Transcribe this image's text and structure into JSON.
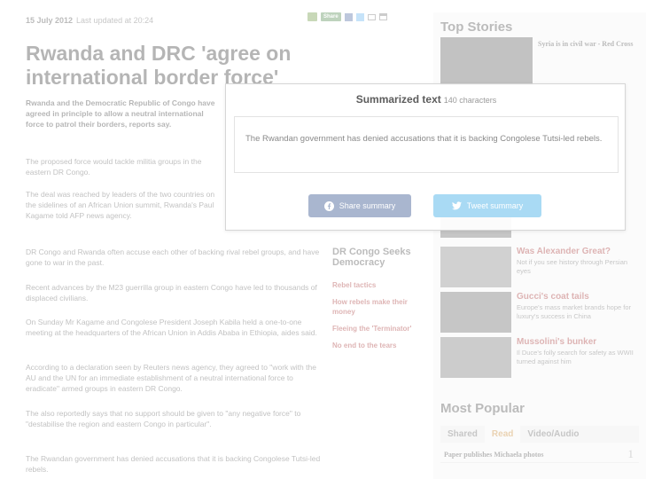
{
  "article": {
    "date": "15 July 2012",
    "updated": "Last updated at 20:24",
    "share_label": "Share",
    "headline": "Rwanda and DRC 'agree on international border force'",
    "lead": "Rwanda and the Democratic Republic of Congo have agreed in principle to allow a neutral international force to patrol their borders, reports say.",
    "paragraphs": [
      "The proposed force would tackle militia groups in the eastern DR Congo.",
      "The deal was reached by leaders of the two countries on the sidelines of an African Union summit, Rwanda's Paul Kagame told AFP news agency.",
      "DR Congo and Rwanda often accuse each other of backing rival rebel groups, and have gone to war in the past.",
      "Recent advances by the M23 guerrilla group in eastern Congo have led to thousands of displaced civilians.",
      "On Sunday Mr Kagame and Congolese President Joseph Kabila held a one-to-one meeting at the headquarters of the African Union in Addis Ababa in Ethiopia, aides said.",
      "According to a declaration seen by Reuters news agency, they agreed to \"work with the AU and the UN for an immediate establishment of a neutral international force to eradicate\" armed groups in eastern DR Congo.",
      "The also reportedly says that no support should be given to \"any negative force\" to \"destabilise the region and eastern Congo in particular\".",
      "The Rwandan government has denied accusations that it is backing Congolese Tutsi-led rebels."
    ]
  },
  "sidebar_box": {
    "title": "DR Congo Seeks Democracy",
    "links": [
      "Rebel tactics",
      "How rebels make their money",
      "Fleeing the 'Terminator'",
      "No end to the tears"
    ]
  },
  "right_column": {
    "top_stories_heading": "Top Stories",
    "top_story": "Syria is in civil war - Red Cross",
    "features": [
      {
        "title": "Was Alexander Great?",
        "desc": "Not if you see history through Persian eyes"
      },
      {
        "title": "Gucci's coat tails",
        "desc": "Europe's mass market brands hope for luxury's success in China"
      },
      {
        "title": "Mussolini's bunker",
        "desc": "Il Duce's folly search for safety as WWII turned against him"
      }
    ],
    "most_popular_heading": "Most Popular",
    "tabs": [
      "Shared",
      "Read",
      "Video/Audio"
    ],
    "popular_items": [
      {
        "title": "Paper publishes Michaela photos",
        "rank": "1"
      }
    ]
  },
  "summary": {
    "title": "Summarized text",
    "count": "140 characters",
    "text": "The Rwandan government has denied accusations that it is backing Congolese Tutsi-led rebels.",
    "share_button": "Share summary",
    "tweet_button": "Tweet summary"
  },
  "colors": {
    "facebook": "#3b5998",
    "twitter": "#55acee",
    "link_red": "#9b1b1b"
  }
}
